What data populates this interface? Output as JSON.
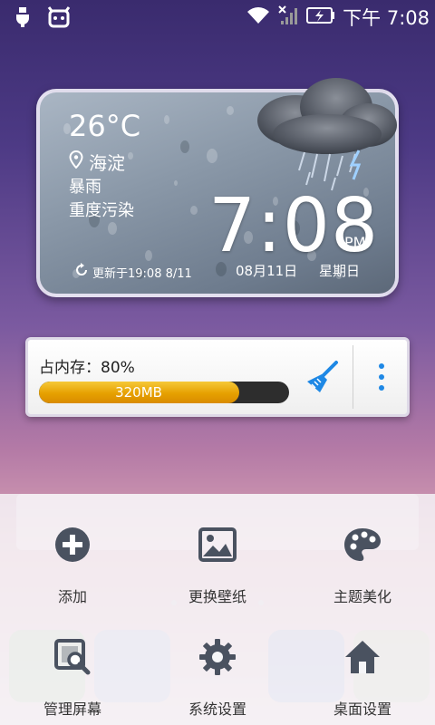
{
  "statusbar": {
    "time": "下午 7:08",
    "icons": [
      "usb-icon",
      "notification-bot-icon",
      "wifi-icon",
      "no-signal-icon",
      "battery-charging-icon"
    ]
  },
  "weather": {
    "temperature": "26°C",
    "location": "海淀",
    "condition": "暴雨",
    "air_quality": "重度污染",
    "clock": "7:08",
    "ampm": "PM",
    "updated": "更新于19:08 8/11",
    "date": "08月11日",
    "weekday": "星期日"
  },
  "memory": {
    "label": "占内存：80%",
    "used_label": "320MB",
    "percent": 80
  },
  "menu": {
    "items": [
      {
        "label": "添加",
        "icon": "add-icon"
      },
      {
        "label": "更换壁纸",
        "icon": "wallpaper-icon"
      },
      {
        "label": "主题美化",
        "icon": "palette-icon"
      },
      {
        "label": "管理屏幕",
        "icon": "manage-screen-icon"
      },
      {
        "label": "系统设置",
        "icon": "gear-icon"
      },
      {
        "label": "桌面设置",
        "icon": "home-icon"
      }
    ]
  },
  "colors": {
    "accent_orange": "#e6a000",
    "broom_blue": "#1e88e5",
    "icon_gray": "#4a5260"
  }
}
